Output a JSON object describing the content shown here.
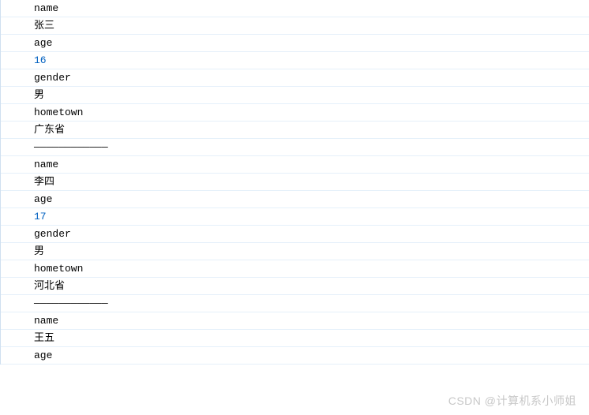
{
  "records": [
    {
      "name_key": "name",
      "name_value": "张三",
      "age_key": "age",
      "age_value": "16",
      "gender_key": "gender",
      "gender_value": "男",
      "hometown_key": "hometown",
      "hometown_value": "广东省",
      "separator": "————————————"
    },
    {
      "name_key": "name",
      "name_value": "李四",
      "age_key": "age",
      "age_value": "17",
      "gender_key": "gender",
      "gender_value": "男",
      "hometown_key": "hometown",
      "hometown_value": "河北省",
      "separator": "————————————"
    },
    {
      "name_key": "name",
      "name_value": "王五",
      "age_key": "age"
    }
  ],
  "watermark": "CSDN @计算机系小师姐"
}
